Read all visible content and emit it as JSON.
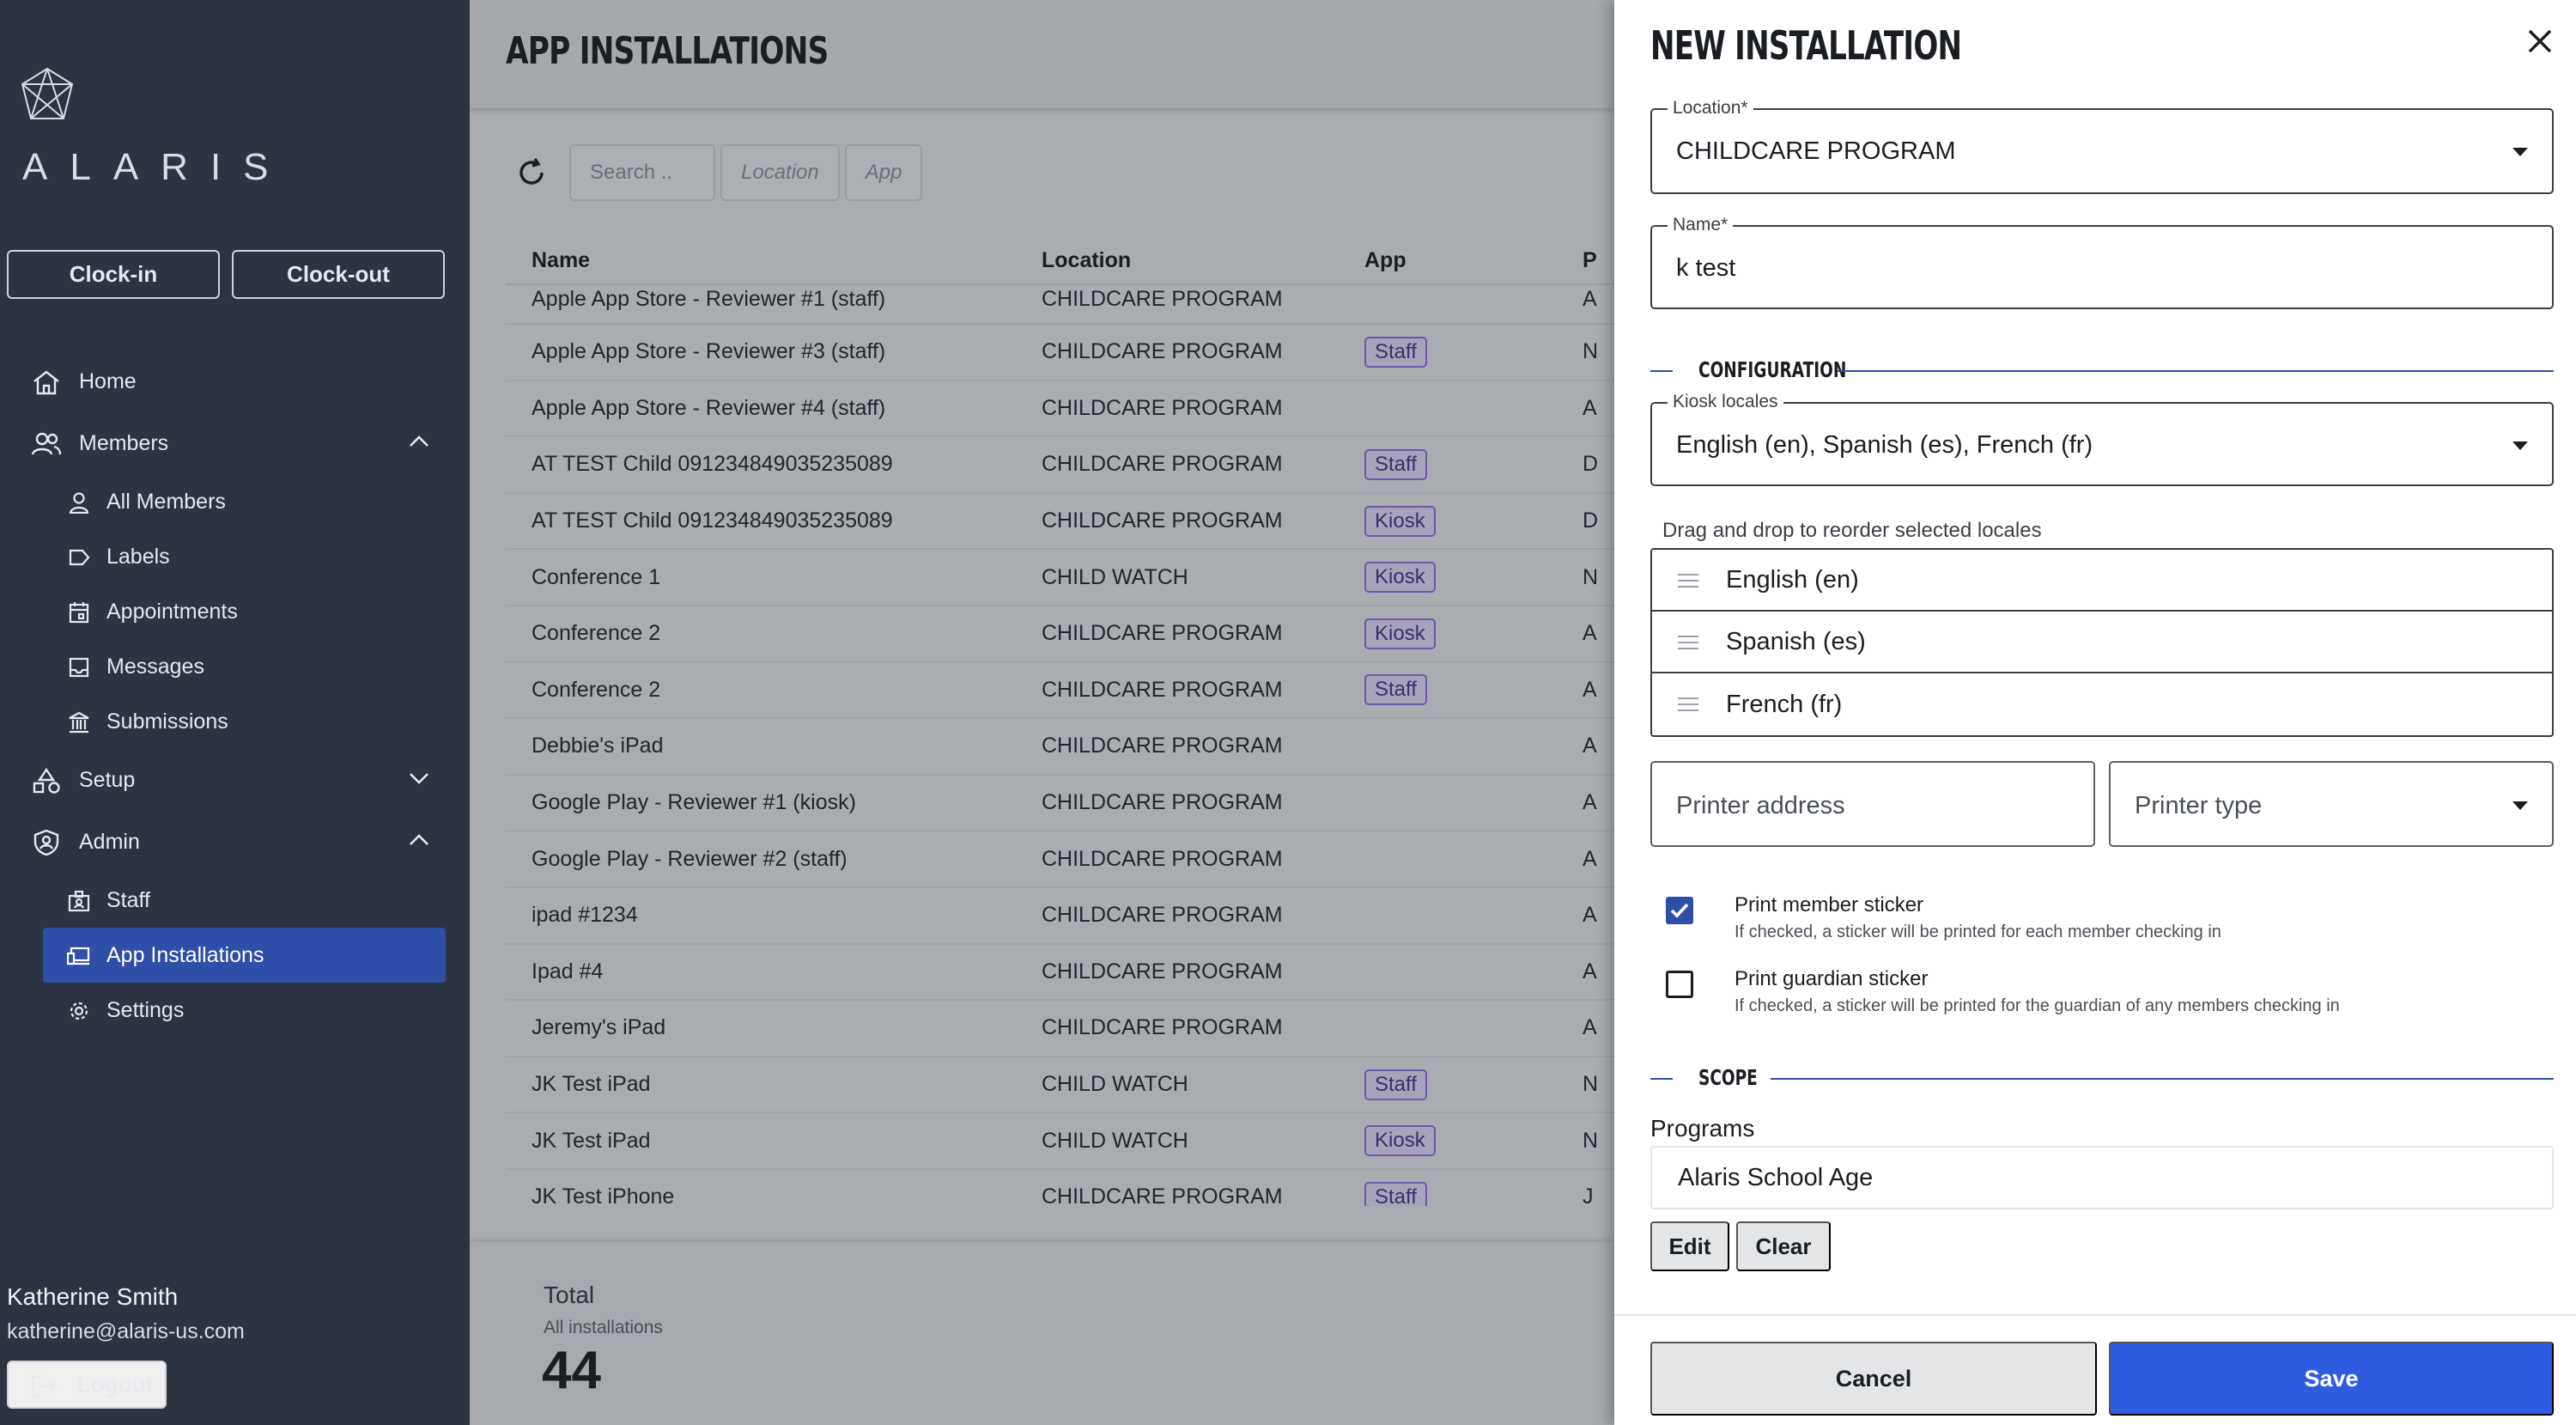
{
  "sidebar": {
    "brand": "ALARIS",
    "clock_in": "Clock-in",
    "clock_out": "Clock-out",
    "nav": {
      "home": "Home",
      "members": "Members",
      "all_members": "All Members",
      "labels": "Labels",
      "appointments": "Appointments",
      "messages": "Messages",
      "submissions": "Submissions",
      "setup": "Setup",
      "admin": "Admin",
      "staff": "Staff",
      "app_installations": "App Installations",
      "settings": "Settings"
    },
    "user": {
      "name": "Katherine Smith",
      "email": "katherine@alaris-us.com"
    },
    "logout": "Logout"
  },
  "main": {
    "title": "APP INSTALLATIONS",
    "filters": {
      "search": "Search ..",
      "location": "Location",
      "app": "App"
    },
    "columns": {
      "name": "Name",
      "location": "Location",
      "app": "App",
      "extra": "P"
    },
    "rows": [
      {
        "name": "Apple App Store - Reviewer #1 (staff)",
        "location": "CHILDCARE PROGRAM",
        "app": "",
        "extra": "A"
      },
      {
        "name": "Apple App Store - Reviewer #3 (staff)",
        "location": "CHILDCARE PROGRAM",
        "app": "Staff",
        "extra": "N"
      },
      {
        "name": "Apple App Store - Reviewer #4 (staff)",
        "location": "CHILDCARE PROGRAM",
        "app": "",
        "extra": "A"
      },
      {
        "name": "AT TEST Child 091234849035235089",
        "location": "CHILDCARE PROGRAM",
        "app": "Staff",
        "extra": "D"
      },
      {
        "name": "AT TEST Child 091234849035235089",
        "location": "CHILDCARE PROGRAM",
        "app": "Kiosk",
        "extra": "D"
      },
      {
        "name": "Conference 1",
        "location": "CHILD WATCH",
        "app": "Kiosk",
        "extra": "N"
      },
      {
        "name": "Conference 2",
        "location": "CHILDCARE PROGRAM",
        "app": "Kiosk",
        "extra": "A"
      },
      {
        "name": "Conference 2",
        "location": "CHILDCARE PROGRAM",
        "app": "Staff",
        "extra": "A"
      },
      {
        "name": "Debbie's iPad",
        "location": "CHILDCARE PROGRAM",
        "app": "",
        "extra": "A"
      },
      {
        "name": "Google Play - Reviewer #1 (kiosk)",
        "location": "CHILDCARE PROGRAM",
        "app": "",
        "extra": "A"
      },
      {
        "name": "Google Play - Reviewer #2 (staff)",
        "location": "CHILDCARE PROGRAM",
        "app": "",
        "extra": "A"
      },
      {
        "name": "ipad #1234",
        "location": "CHILDCARE PROGRAM",
        "app": "",
        "extra": "A"
      },
      {
        "name": "Ipad #4",
        "location": "CHILDCARE PROGRAM",
        "app": "",
        "extra": "A"
      },
      {
        "name": "Jeremy's iPad",
        "location": "CHILDCARE PROGRAM",
        "app": "",
        "extra": "A"
      },
      {
        "name": "JK Test iPad",
        "location": "CHILD WATCH",
        "app": "Staff",
        "extra": "N"
      },
      {
        "name": "JK Test iPad",
        "location": "CHILD WATCH",
        "app": "Kiosk",
        "extra": "N"
      },
      {
        "name": "JK Test iPhone",
        "location": "CHILDCARE PROGRAM",
        "app": "Staff",
        "extra": "J"
      }
    ],
    "total": {
      "label": "Total",
      "sub": "All installations",
      "value": "44"
    }
  },
  "drawer": {
    "title": "NEW INSTALLATION",
    "location": {
      "label": "Location*",
      "value": "CHILDCARE PROGRAM"
    },
    "name": {
      "label": "Name*",
      "value": "k test"
    },
    "configuration_label": "CONFIGURATION",
    "kiosk_locales": {
      "label": "Kiosk locales",
      "value": "English (en), Spanish (es), French (fr)"
    },
    "drag_helper": "Drag and drop to reorder selected locales",
    "locales": [
      "English (en)",
      "Spanish (es)",
      "French (fr)"
    ],
    "printer_address_placeholder": "Printer address",
    "printer_type_placeholder": "Printer type",
    "print_member": {
      "label": "Print member sticker",
      "help": "If checked, a sticker will be printed for each member checking in",
      "checked": true
    },
    "print_guardian": {
      "label": "Print guardian sticker",
      "help": "If checked, a sticker will be printed for the guardian of any members checking in",
      "checked": false
    },
    "scope_label": "SCOPE",
    "programs_label": "Programs",
    "programs_value": "Alaris School Age",
    "edit": "Edit",
    "clear": "Clear",
    "cancel": "Cancel",
    "save": "Save"
  },
  "colors": {
    "accent": "#2f5be0",
    "active_nav": "#2e4fa8",
    "sidebar_bg": "#2b3440"
  }
}
